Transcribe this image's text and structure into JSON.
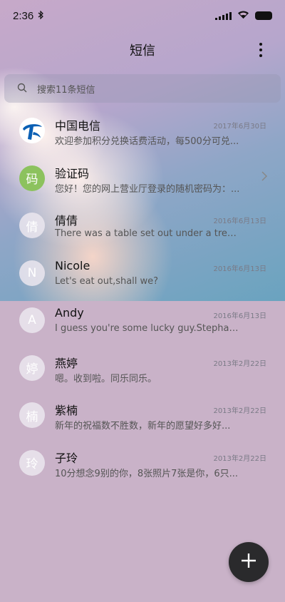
{
  "status_bar": {
    "time": "2:36",
    "bluetooth_icon": "bluetooth-icon",
    "signal_icon": "signal-icon",
    "wifi_icon": "wifi-icon",
    "battery_icon": "battery-icon"
  },
  "header": {
    "title": "短信",
    "more_icon": "more-vertical-icon"
  },
  "search": {
    "placeholder": "搜索11条短信",
    "icon": "search-icon"
  },
  "conversations": [
    {
      "avatar_type": "logo",
      "avatar_text": "",
      "name": "中国电信",
      "date": "2017年6月30日",
      "preview": "欢迎参加积分兑换话费活动，每500分可兑..."
    },
    {
      "avatar_type": "green",
      "avatar_text": "码",
      "name": "验证码",
      "date": "",
      "preview": "您好！您的网上营业厅登录的随机密码为：...",
      "chevron": true
    },
    {
      "avatar_type": "letter",
      "avatar_text": "倩",
      "name": "倩倩",
      "date": "2016年6月13日",
      "preview": "There was a table set out under a tree in..."
    },
    {
      "avatar_type": "letter",
      "avatar_text": "N",
      "name": "Nicole",
      "date": "2016年6月13日",
      "preview": "Let's eat out,shall we?"
    },
    {
      "avatar_type": "letter",
      "avatar_text": "A",
      "name": "Andy",
      "date": "2016年6月13日",
      "preview": "I guess you're some lucky guy.Stephani..."
    },
    {
      "avatar_type": "letter",
      "avatar_text": "婷",
      "name": "燕婷",
      "date": "2013年2月22日",
      "preview": "嗯。收到啦。同乐同乐。"
    },
    {
      "avatar_type": "letter",
      "avatar_text": "楠",
      "name": "紫楠",
      "date": "2013年2月22日",
      "preview": "新年的祝福数不胜数，新年的愿望好多好..."
    },
    {
      "avatar_type": "letter",
      "avatar_text": "玲",
      "name": "子玲",
      "date": "2013年2月22日",
      "preview": "10分想念9别的你，8张照片7张是你，6只..."
    }
  ],
  "compose": {
    "icon": "plus-icon"
  },
  "colors": {
    "fab_bg": "#2a2a2c",
    "verify_avatar": "#8cc25e",
    "telecom_blue": "#0a5fb4"
  }
}
